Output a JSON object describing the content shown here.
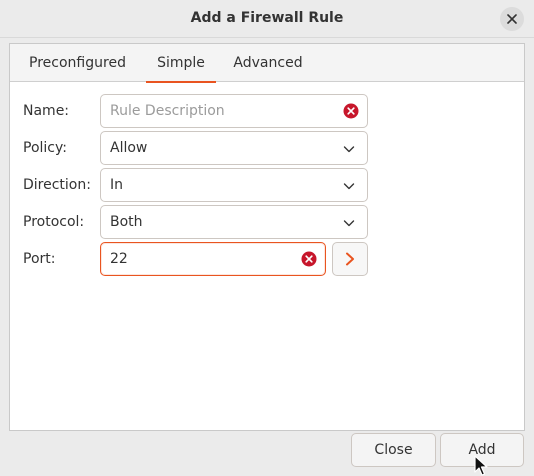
{
  "window": {
    "title": "Add a Firewall Rule",
    "close_icon": "close-icon"
  },
  "tabs": [
    {
      "label": "Preconfigured",
      "active": false
    },
    {
      "label": "Simple",
      "active": true
    },
    {
      "label": "Advanced",
      "active": false
    }
  ],
  "form": {
    "name": {
      "label": "Name:",
      "value": "",
      "placeholder": "Rule Description"
    },
    "policy": {
      "label": "Policy:",
      "value": "Allow"
    },
    "direction": {
      "label": "Direction:",
      "value": "In"
    },
    "protocol": {
      "label": "Protocol:",
      "value": "Both"
    },
    "port": {
      "label": "Port:",
      "value": "22"
    }
  },
  "buttons": {
    "close_label": "Close",
    "add_label": "Add"
  },
  "colors": {
    "accent": "#e95420",
    "clear_icon": "#c7162b"
  }
}
